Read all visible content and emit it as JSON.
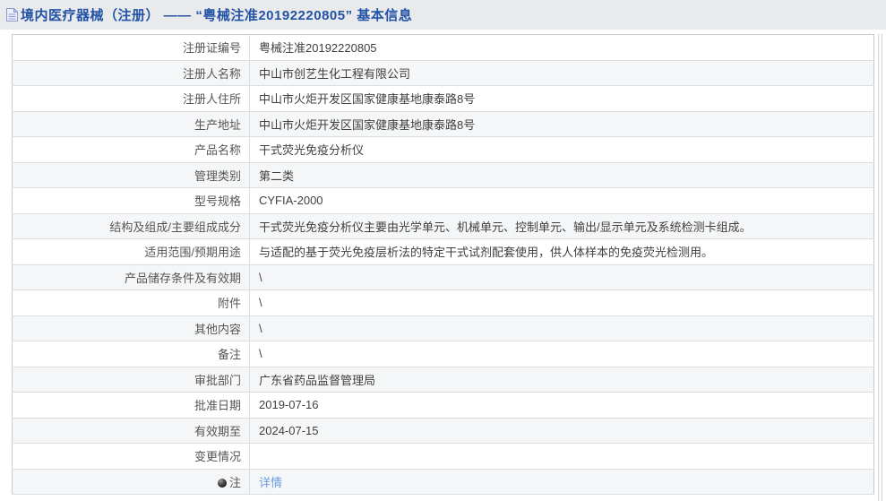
{
  "header": {
    "icon": "document-icon",
    "title": "境内医疗器械（注册） —— “粤械注准20192220805” 基本信息"
  },
  "colors": {
    "header_bg": "#e9eaeb",
    "title_blue": "#2353a6",
    "link_blue": "#6b9de4",
    "stripe_gray": "#f5f6f7",
    "border_gray": "#dcddde",
    "label_text": "#555555",
    "value_text": "#3f3f3f"
  },
  "table": {
    "rows": [
      {
        "label": "注册证编号",
        "value": "粤械注准20192220805"
      },
      {
        "label": "注册人名称",
        "value": "中山市创艺生化工程有限公司"
      },
      {
        "label": "注册人住所",
        "value": "中山市火炬开发区国家健康基地康泰路8号"
      },
      {
        "label": "生产地址",
        "value": "中山市火炬开发区国家健康基地康泰路8号"
      },
      {
        "label": "产品名称",
        "value": "干式荧光免疫分析仪"
      },
      {
        "label": "管理类别",
        "value": "第二类"
      },
      {
        "label": "型号规格",
        "value": "CYFIA-2000"
      },
      {
        "label": "结构及组成/主要组成成分",
        "value": "干式荧光免疫分析仪主要由光学单元、机械单元、控制单元、输出/显示单元及系统检测卡组成。"
      },
      {
        "label": "适用范围/预期用途",
        "value": "与适配的基于荧光免疫层析法的特定干式试剂配套使用，供人体样本的免疫荧光检测用。"
      },
      {
        "label": "产品储存条件及有效期",
        "value": "\\"
      },
      {
        "label": "附件",
        "value": "\\"
      },
      {
        "label": "其他内容",
        "value": "\\"
      },
      {
        "label": "备注",
        "value": "\\"
      },
      {
        "label": "审批部门",
        "value": "广东省药品监督管理局"
      },
      {
        "label": "批准日期",
        "value": "2019-07-16"
      },
      {
        "label": "有效期至",
        "value": "2024-07-15"
      },
      {
        "label": "变更情况",
        "value": ""
      },
      {
        "label": "注",
        "label_icon": "dot-icon",
        "value": "详情",
        "value_type": "link"
      }
    ]
  }
}
